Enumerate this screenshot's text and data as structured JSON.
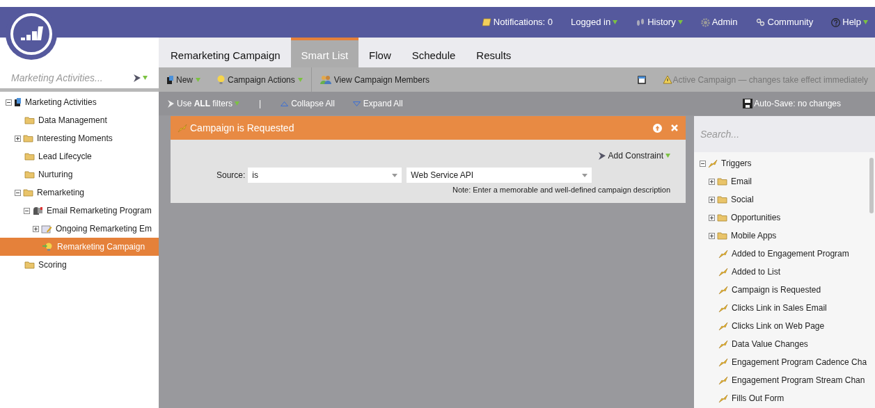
{
  "header": {
    "links": [
      {
        "label": "Notifications: 0",
        "menu": false
      },
      {
        "label": "Logged in",
        "menu": true
      },
      {
        "label": "History",
        "menu": true
      },
      {
        "label": "Admin",
        "menu": false
      },
      {
        "label": "Community",
        "menu": false
      },
      {
        "label": "Help",
        "menu": true
      }
    ]
  },
  "tabs": [
    {
      "label": "Remarketing Campaign",
      "selected": false
    },
    {
      "label": "Smart List",
      "selected": true
    },
    {
      "label": "Flow",
      "selected": false
    },
    {
      "label": "Schedule",
      "selected": false
    },
    {
      "label": "Results",
      "selected": false
    }
  ],
  "sidebar": {
    "search": {
      "placeholder": "Marketing Activities..."
    },
    "tree": [
      {
        "label": "Marketing Activities",
        "kind": "root",
        "expanded": true,
        "selected": false,
        "children": [
          {
            "label": "Data Management",
            "kind": "folder",
            "selected": false
          },
          {
            "label": "Interesting Moments",
            "kind": "folder",
            "expanded": false,
            "selected": false
          },
          {
            "label": "Lead Lifecycle",
            "kind": "folder",
            "selected": false
          },
          {
            "label": "Nurturing",
            "kind": "folder",
            "selected": false
          },
          {
            "label": "Remarketing",
            "kind": "folder",
            "expanded": true,
            "selected": false,
            "children": [
              {
                "label": "Email Remarketing Program",
                "kind": "program",
                "expanded": true,
                "selected": false,
                "children": [
                  {
                    "label": "Ongoing Remarketing Em",
                    "kind": "nurture",
                    "expanded": false,
                    "selected": false
                  },
                  {
                    "label": "Remarketing Campaign",
                    "kind": "campaign",
                    "selected": true
                  }
                ]
              }
            ]
          },
          {
            "label": "Scoring",
            "kind": "folder",
            "selected": false
          }
        ]
      }
    ]
  },
  "toolbar": {
    "buttons": [
      {
        "label": "New",
        "menu": true
      },
      {
        "label": "Campaign Actions",
        "menu": true
      },
      {
        "label": "View Campaign Members",
        "menu": false
      }
    ],
    "notice": "Active Campaign — changes take effect immediately"
  },
  "filter_bar": {
    "use_filters": "Use **ALL** filters",
    "separator": "|",
    "collapse": "Collapse All",
    "expand": "Expand All",
    "autosave": "Auto-Save: no changes"
  },
  "filter": {
    "title": "Campaign is Requested",
    "add_constraint": "Add Constraint",
    "label": "Source:",
    "operator": "is",
    "value": "Web Service API",
    "note": "Note: Enter a memorable and well-defined campaign description"
  },
  "triggers": {
    "search": {
      "placeholder": "Search..."
    },
    "tree": [
      {
        "label": "Triggers",
        "kind": "trigger",
        "expanded": true,
        "children": [
          {
            "label": "Email",
            "kind": "folder",
            "expanded": false
          },
          {
            "label": "Social",
            "kind": "folder",
            "expanded": false
          },
          {
            "label": "Opportunities",
            "kind": "folder",
            "expanded": false
          },
          {
            "label": "Mobile Apps",
            "kind": "folder",
            "expanded": false
          },
          {
            "label": "Added to Engagement Program",
            "kind": "trigger"
          },
          {
            "label": "Added to List",
            "kind": "trigger"
          },
          {
            "label": "Campaign is Requested",
            "kind": "trigger"
          },
          {
            "label": "Clicks Link in Sales Email",
            "kind": "trigger"
          },
          {
            "label": "Clicks Link on Web Page",
            "kind": "trigger"
          },
          {
            "label": "Data Value Changes",
            "kind": "trigger"
          },
          {
            "label": "Engagement Program Cadence Cha",
            "kind": "trigger"
          },
          {
            "label": "Engagement Program Stream Chan",
            "kind": "trigger"
          },
          {
            "label": "Fills Out Form",
            "kind": "trigger"
          }
        ]
      }
    ]
  }
}
